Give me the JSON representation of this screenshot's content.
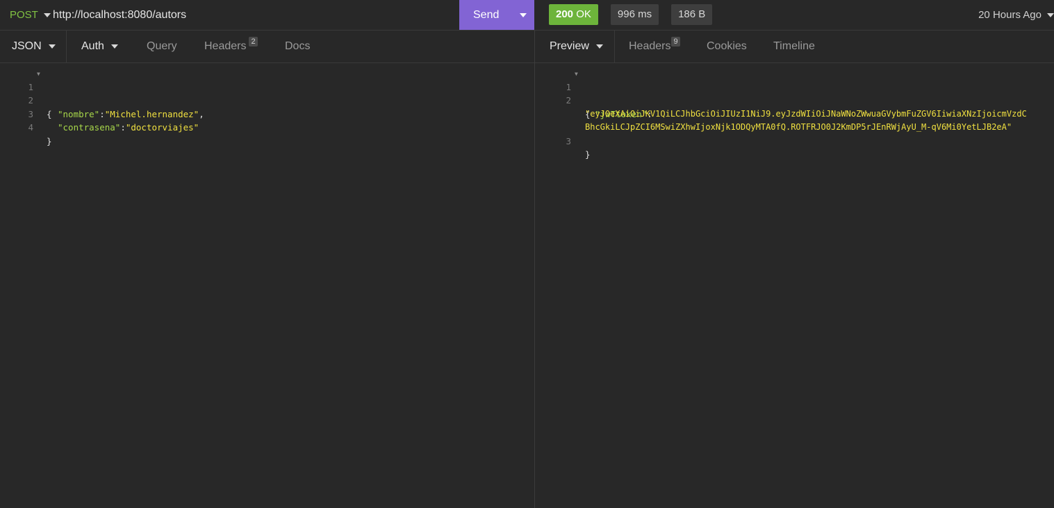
{
  "request": {
    "method": "POST",
    "url": "http://localhost:8080/autors",
    "send_label": "Send"
  },
  "response_meta": {
    "status_code": "200",
    "status_text": "OK",
    "time": "996 ms",
    "size": "186 B",
    "ago": "20 Hours Ago"
  },
  "colors": {
    "method": "#80c242",
    "send": "#8264d4",
    "status_ok": "#6db43b",
    "json_key": "#a8d84a",
    "json_string": "#f0e040"
  },
  "request_tabs": {
    "body_type": "JSON",
    "auth": "Auth",
    "query": "Query",
    "headers": "Headers",
    "headers_count": "2",
    "docs": "Docs"
  },
  "response_tabs": {
    "preview": "Preview",
    "headers": "Headers",
    "headers_count": "9",
    "cookies": "Cookies",
    "timeline": "Timeline"
  },
  "request_body": {
    "line_numbers": [
      "1",
      "2",
      "3",
      "4"
    ],
    "open_brace": "{",
    "close_brace": "}",
    "fields": [
      {
        "key": "\"nombre\"",
        "colon": ":",
        "value": "\"Michel.hernandez\"",
        "comma": ","
      },
      {
        "key": "\"contrasena\"",
        "colon": ":",
        "value": "\"doctorviajes\"",
        "comma": ""
      }
    ]
  },
  "response_body": {
    "line_numbers": [
      "1",
      "2",
      "3"
    ],
    "open_brace": "{",
    "close_brace": "}",
    "key": "\"jwTtoken\"",
    "colon": ":",
    "token_line1": "\"eyJ0eXAiOiJKV1QiLCJhbGciOiJIUzI1NiJ9.eyJzdWIiOiJNaWNoZWwuaGVybmFuZGV6IiwiaXNzIjoicmVzdC",
    "token_line2": "BhcGkiLCJpZCI6MSwiZXhwIjoxNjk1ODQyMTA0fQ.ROTFRJO0J2KmDP5rJEnRWjAyU_M-qV6Mi0YetLJB2eA\""
  }
}
